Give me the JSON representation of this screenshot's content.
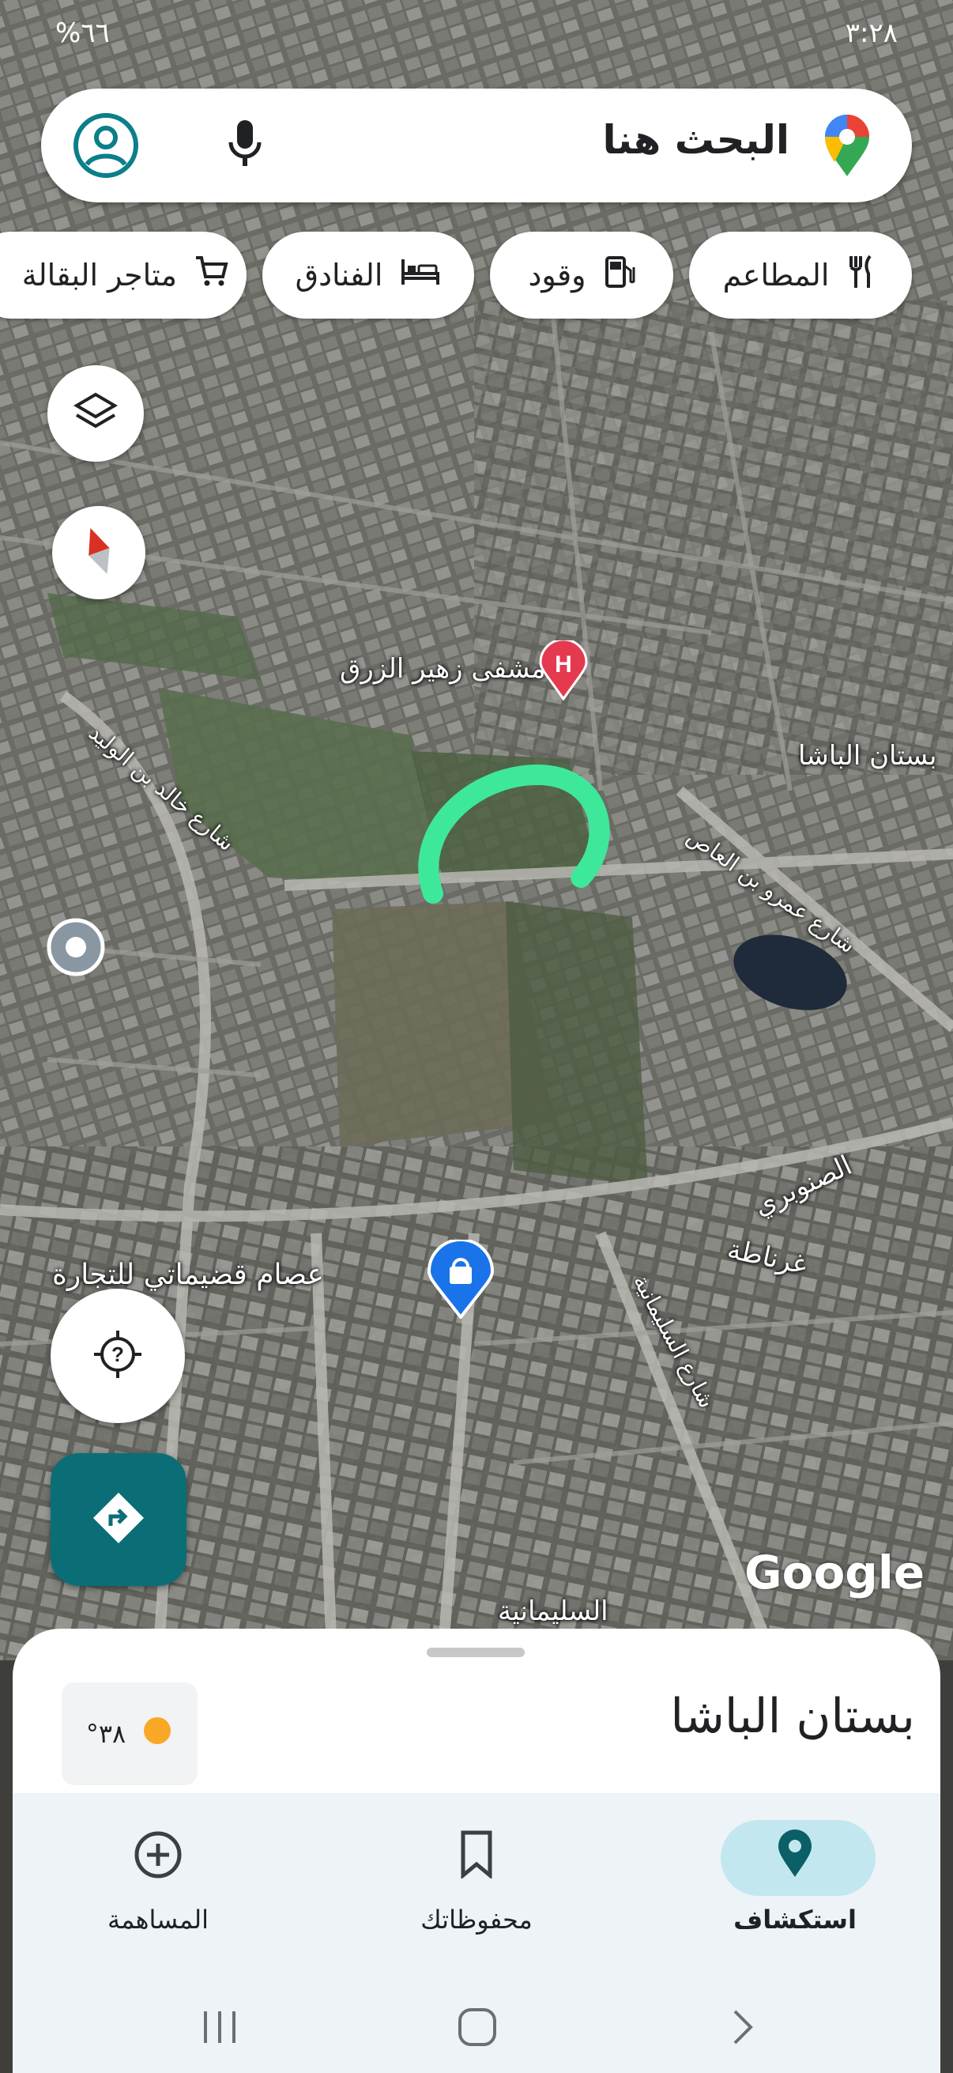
{
  "status_bar": {
    "battery": "%٦٦",
    "time": "٣:٢٨"
  },
  "search": {
    "placeholder": "البحث هنا"
  },
  "chips": [
    {
      "label": "المطاعم",
      "icon": "restaurant-icon"
    },
    {
      "label": "وقود",
      "icon": "fuel-icon"
    },
    {
      "label": "الفنادق",
      "icon": "hotel-icon"
    },
    {
      "label": "متاجر البقالة",
      "icon": "shopping-cart-icon"
    }
  ],
  "map_labels": {
    "hospital": "مشفى زهير الزرق",
    "area_basha": "بستان الباشا",
    "street_khalid": "شارع خالد بن الوليد",
    "street_amr": "شارع عمرو بن العاص",
    "area_sanobari": "الصنوبري",
    "area_granada": "غرناطة",
    "store": "عصام قضيماتي للتجارة",
    "street_sulaymaniyah": "شارع السليمانية",
    "area_sulaymaniyah": "السليمانية"
  },
  "map_branding": "Google",
  "place_sheet": {
    "title": "بستان الباشا",
    "temperature": "°٣٨"
  },
  "bottom_nav": [
    {
      "label": "استكشاف",
      "icon": "explore-pin-icon",
      "active": true
    },
    {
      "label": "محفوظاتك",
      "icon": "bookmark-icon",
      "active": false
    },
    {
      "label": "المساهمة",
      "icon": "add-circle-icon",
      "active": false
    }
  ],
  "colors": {
    "accent_teal": "#0b6e76",
    "active_pill": "#c2e7ef",
    "drawn_mark": "#3ee89a",
    "hospital_pin": "#e53950",
    "store_pin": "#1a73e8"
  }
}
